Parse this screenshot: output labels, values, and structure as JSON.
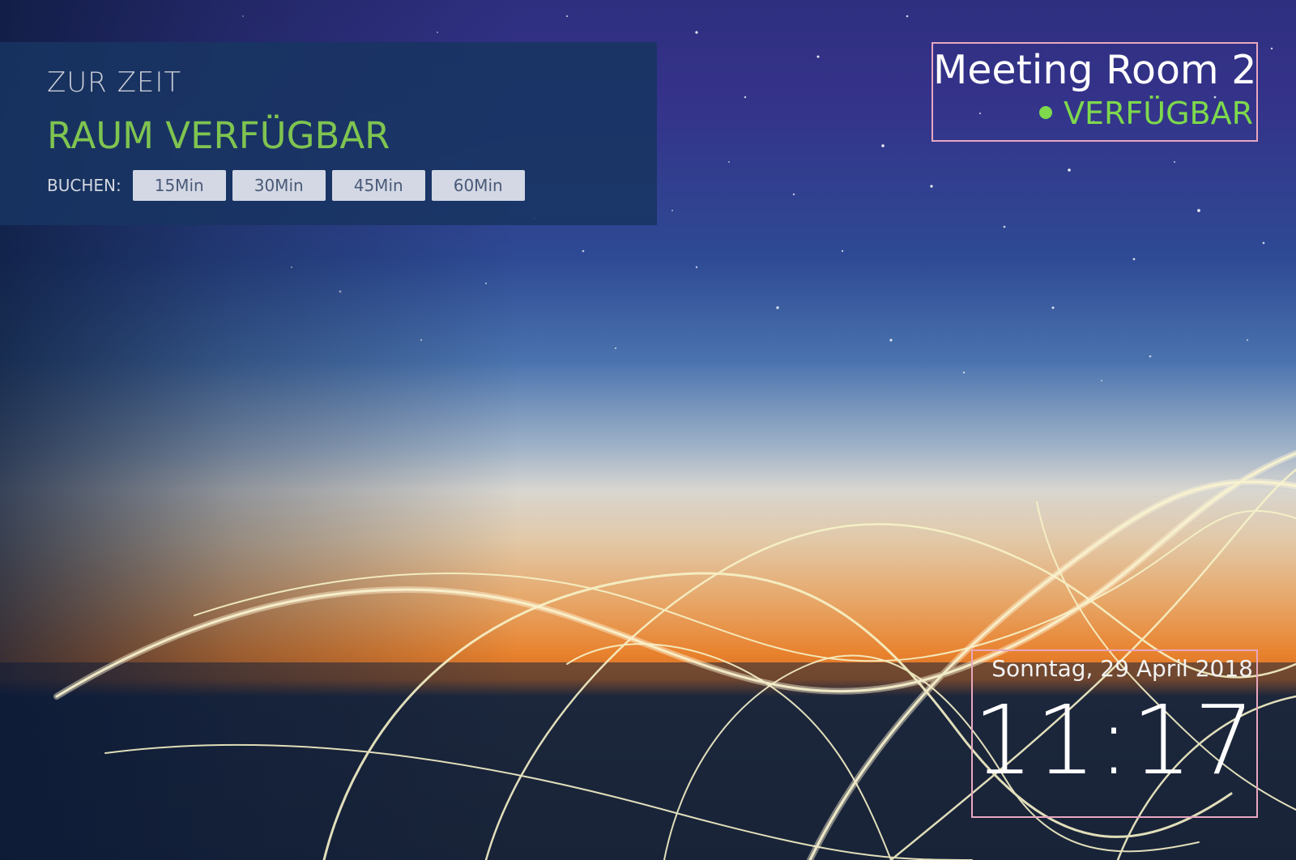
{
  "status_panel": {
    "caption": "ZUR ZEIT",
    "state": "RAUM VERFÜGBAR",
    "state_color": "#7fc450",
    "book_label": "BUCHEN:",
    "book_options": [
      "15Min",
      "30Min",
      "45Min",
      "60Min"
    ]
  },
  "room": {
    "name": "Meeting Room 2",
    "status": "VERFÜGBAR",
    "status_color": "#7ed94c"
  },
  "clock": {
    "date": "Sonntag, 29 April 2018",
    "time": "11:17"
  }
}
